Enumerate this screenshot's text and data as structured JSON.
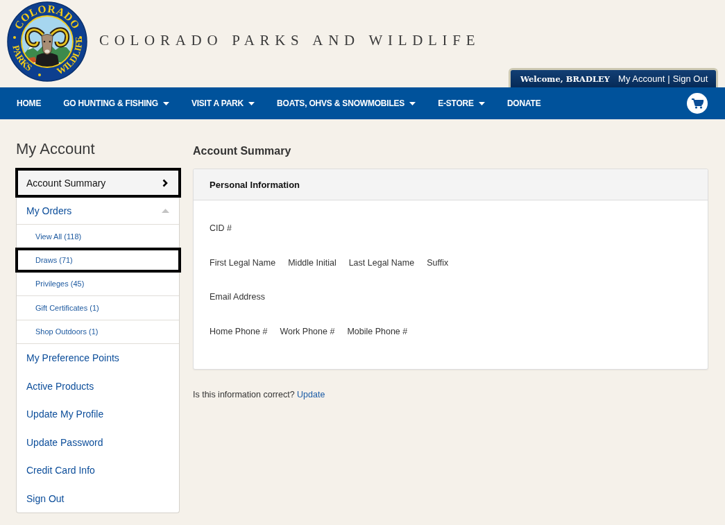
{
  "header": {
    "logo": {
      "top": "COLORADO",
      "bottom_left": "PARKS",
      "bottom_right": "WILDLIFE"
    },
    "site_title": "COLORADO PARKS AND WILDLIFE",
    "account_bar": {
      "welcome": "Welcome, BRADLEY",
      "links": [
        {
          "label": "My Account"
        },
        {
          "label": "Sign Out"
        }
      ],
      "separator": "|"
    }
  },
  "nav": {
    "items": [
      {
        "label": "HOME",
        "has_menu": false
      },
      {
        "label": "GO HUNTING & FISHING",
        "has_menu": true
      },
      {
        "label": "VISIT A PARK",
        "has_menu": true
      },
      {
        "label": "BOATS, OHVS & SNOWMOBILES",
        "has_menu": true
      },
      {
        "label": "E-STORE",
        "has_menu": true
      },
      {
        "label": "DONATE",
        "has_menu": false
      }
    ]
  },
  "sidebar": {
    "title": "My Account",
    "items": [
      {
        "label": "Account Summary",
        "kind": "link",
        "selected": true,
        "highlighted": true
      },
      {
        "label": "My Orders",
        "kind": "group",
        "selected": false,
        "highlighted": false,
        "expanded": true,
        "children": [
          {
            "label": "View All (118)",
            "selected": false,
            "highlighted": false
          },
          {
            "label": "Draws (71)",
            "selected": false,
            "highlighted": true
          },
          {
            "label": "Privileges (45)",
            "selected": false,
            "highlighted": false
          },
          {
            "label": "Gift Certificates (1)",
            "selected": false,
            "highlighted": false
          },
          {
            "label": "Shop Outdoors (1)",
            "selected": false,
            "highlighted": false
          }
        ]
      },
      {
        "label": "My Preference Points",
        "kind": "link",
        "selected": false,
        "highlighted": false
      },
      {
        "label": "Active Products",
        "kind": "link",
        "selected": false,
        "highlighted": false
      },
      {
        "label": "Update My Profile",
        "kind": "link",
        "selected": false,
        "highlighted": false
      },
      {
        "label": "Update Password",
        "kind": "link",
        "selected": false,
        "highlighted": false
      },
      {
        "label": "Credit Card Info",
        "kind": "link",
        "selected": false,
        "highlighted": false
      },
      {
        "label": "Sign Out",
        "kind": "link",
        "selected": false,
        "highlighted": false
      }
    ]
  },
  "main": {
    "title": "Account Summary",
    "card": {
      "title": "Personal Information",
      "rows": [
        [
          "CID #"
        ],
        [
          "First Legal Name",
          "Middle Initial",
          "Last Legal Name",
          "Suffix"
        ],
        [
          "Email Address"
        ],
        [
          "Home Phone #",
          "Work Phone #",
          "Mobile Phone #"
        ]
      ]
    },
    "confirm": {
      "question": "Is this information correct?",
      "link": "Update"
    }
  }
}
